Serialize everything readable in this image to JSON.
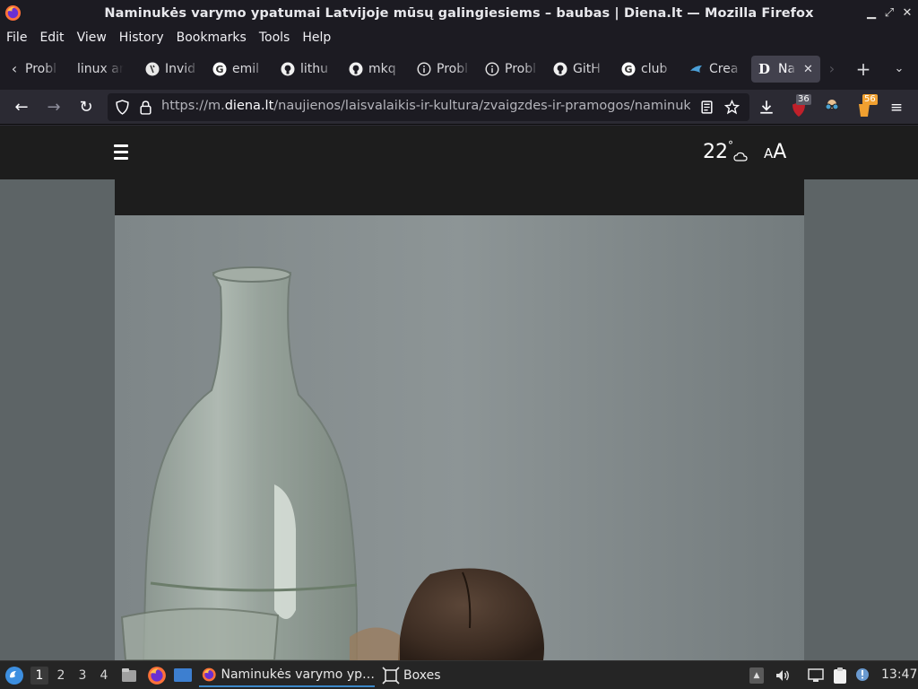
{
  "window": {
    "title": "Naminukės varymo ypatumai Latvijoje mūsų galingiesiems – baubas | Diena.lt — Mozilla Firefox"
  },
  "menu": {
    "items": [
      "File",
      "Edit",
      "View",
      "History",
      "Bookmarks",
      "Tools",
      "Help"
    ]
  },
  "tabs": [
    {
      "label": "Probl",
      "icon": "info-icon"
    },
    {
      "label": "linux an",
      "icon": "none"
    },
    {
      "label": "Invid",
      "icon": "invidious-icon"
    },
    {
      "label": "emil",
      "icon": "google-icon"
    },
    {
      "label": "lithu",
      "icon": "github-icon"
    },
    {
      "label": "mkq",
      "icon": "github-icon"
    },
    {
      "label": "Probl",
      "icon": "info-icon"
    },
    {
      "label": "Probl",
      "icon": "info-icon"
    },
    {
      "label": "GitH",
      "icon": "github-icon"
    },
    {
      "label": "club",
      "icon": "google-icon"
    },
    {
      "label": "Crea",
      "icon": "steam-icon"
    },
    {
      "label": "Na",
      "icon": "diena-icon",
      "active": true
    }
  ],
  "navbar": {
    "url_prefix": "https://m.",
    "url_host": "diena.lt",
    "url_path": "/naujienos/laisvalaikis-ir-kultura/zvaigzdes-ir-pramogos/naminukes",
    "ext_badge_1": "36",
    "ext_badge_2": "56"
  },
  "site": {
    "weather_temp": "22",
    "weather_unit": "°",
    "font_size_small": "A",
    "font_size_large": "A"
  },
  "taskbar": {
    "workspaces": [
      "1",
      "2",
      "3",
      "4"
    ],
    "active_workspace": "1",
    "tasks": [
      {
        "label": "Naminukės varymo yp…",
        "icon": "firefox-icon",
        "active": true
      },
      {
        "label": "Boxes",
        "icon": "boxes-icon",
        "active": false
      }
    ],
    "clock": "13:47"
  },
  "colors": {
    "titlebar": "#1c1b22",
    "toolbar": "#2b2a33",
    "site_header": "#1d1d1d",
    "page_bg": "#5d6466"
  }
}
